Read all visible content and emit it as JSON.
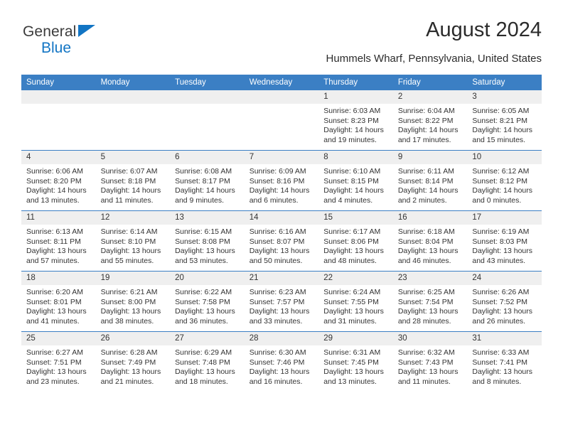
{
  "brand": {
    "name_part1": "General",
    "name_part2": "Blue",
    "accent_color": "#1275c4"
  },
  "header": {
    "title": "August 2024",
    "location": "Hummels Wharf, Pennsylvania, United States"
  },
  "theme": {
    "header_row_color": "#3b7fc4",
    "daynum_bg": "#efefef",
    "text_color": "#333333"
  },
  "weekday_headers": [
    "Sunday",
    "Monday",
    "Tuesday",
    "Wednesday",
    "Thursday",
    "Friday",
    "Saturday"
  ],
  "weeks": [
    [
      {
        "day": "",
        "sunrise": "",
        "sunset": "",
        "daylight1": "",
        "daylight2": "",
        "empty": true
      },
      {
        "day": "",
        "sunrise": "",
        "sunset": "",
        "daylight1": "",
        "daylight2": "",
        "empty": true
      },
      {
        "day": "",
        "sunrise": "",
        "sunset": "",
        "daylight1": "",
        "daylight2": "",
        "empty": true
      },
      {
        "day": "",
        "sunrise": "",
        "sunset": "",
        "daylight1": "",
        "daylight2": "",
        "empty": true
      },
      {
        "day": "1",
        "sunrise": "Sunrise: 6:03 AM",
        "sunset": "Sunset: 8:23 PM",
        "daylight1": "Daylight: 14 hours",
        "daylight2": "and 19 minutes."
      },
      {
        "day": "2",
        "sunrise": "Sunrise: 6:04 AM",
        "sunset": "Sunset: 8:22 PM",
        "daylight1": "Daylight: 14 hours",
        "daylight2": "and 17 minutes."
      },
      {
        "day": "3",
        "sunrise": "Sunrise: 6:05 AM",
        "sunset": "Sunset: 8:21 PM",
        "daylight1": "Daylight: 14 hours",
        "daylight2": "and 15 minutes."
      }
    ],
    [
      {
        "day": "4",
        "sunrise": "Sunrise: 6:06 AM",
        "sunset": "Sunset: 8:20 PM",
        "daylight1": "Daylight: 14 hours",
        "daylight2": "and 13 minutes."
      },
      {
        "day": "5",
        "sunrise": "Sunrise: 6:07 AM",
        "sunset": "Sunset: 8:18 PM",
        "daylight1": "Daylight: 14 hours",
        "daylight2": "and 11 minutes."
      },
      {
        "day": "6",
        "sunrise": "Sunrise: 6:08 AM",
        "sunset": "Sunset: 8:17 PM",
        "daylight1": "Daylight: 14 hours",
        "daylight2": "and 9 minutes."
      },
      {
        "day": "7",
        "sunrise": "Sunrise: 6:09 AM",
        "sunset": "Sunset: 8:16 PM",
        "daylight1": "Daylight: 14 hours",
        "daylight2": "and 6 minutes."
      },
      {
        "day": "8",
        "sunrise": "Sunrise: 6:10 AM",
        "sunset": "Sunset: 8:15 PM",
        "daylight1": "Daylight: 14 hours",
        "daylight2": "and 4 minutes."
      },
      {
        "day": "9",
        "sunrise": "Sunrise: 6:11 AM",
        "sunset": "Sunset: 8:14 PM",
        "daylight1": "Daylight: 14 hours",
        "daylight2": "and 2 minutes."
      },
      {
        "day": "10",
        "sunrise": "Sunrise: 6:12 AM",
        "sunset": "Sunset: 8:12 PM",
        "daylight1": "Daylight: 14 hours",
        "daylight2": "and 0 minutes."
      }
    ],
    [
      {
        "day": "11",
        "sunrise": "Sunrise: 6:13 AM",
        "sunset": "Sunset: 8:11 PM",
        "daylight1": "Daylight: 13 hours",
        "daylight2": "and 57 minutes."
      },
      {
        "day": "12",
        "sunrise": "Sunrise: 6:14 AM",
        "sunset": "Sunset: 8:10 PM",
        "daylight1": "Daylight: 13 hours",
        "daylight2": "and 55 minutes."
      },
      {
        "day": "13",
        "sunrise": "Sunrise: 6:15 AM",
        "sunset": "Sunset: 8:08 PM",
        "daylight1": "Daylight: 13 hours",
        "daylight2": "and 53 minutes."
      },
      {
        "day": "14",
        "sunrise": "Sunrise: 6:16 AM",
        "sunset": "Sunset: 8:07 PM",
        "daylight1": "Daylight: 13 hours",
        "daylight2": "and 50 minutes."
      },
      {
        "day": "15",
        "sunrise": "Sunrise: 6:17 AM",
        "sunset": "Sunset: 8:06 PM",
        "daylight1": "Daylight: 13 hours",
        "daylight2": "and 48 minutes."
      },
      {
        "day": "16",
        "sunrise": "Sunrise: 6:18 AM",
        "sunset": "Sunset: 8:04 PM",
        "daylight1": "Daylight: 13 hours",
        "daylight2": "and 46 minutes."
      },
      {
        "day": "17",
        "sunrise": "Sunrise: 6:19 AM",
        "sunset": "Sunset: 8:03 PM",
        "daylight1": "Daylight: 13 hours",
        "daylight2": "and 43 minutes."
      }
    ],
    [
      {
        "day": "18",
        "sunrise": "Sunrise: 6:20 AM",
        "sunset": "Sunset: 8:01 PM",
        "daylight1": "Daylight: 13 hours",
        "daylight2": "and 41 minutes."
      },
      {
        "day": "19",
        "sunrise": "Sunrise: 6:21 AM",
        "sunset": "Sunset: 8:00 PM",
        "daylight1": "Daylight: 13 hours",
        "daylight2": "and 38 minutes."
      },
      {
        "day": "20",
        "sunrise": "Sunrise: 6:22 AM",
        "sunset": "Sunset: 7:58 PM",
        "daylight1": "Daylight: 13 hours",
        "daylight2": "and 36 minutes."
      },
      {
        "day": "21",
        "sunrise": "Sunrise: 6:23 AM",
        "sunset": "Sunset: 7:57 PM",
        "daylight1": "Daylight: 13 hours",
        "daylight2": "and 33 minutes."
      },
      {
        "day": "22",
        "sunrise": "Sunrise: 6:24 AM",
        "sunset": "Sunset: 7:55 PM",
        "daylight1": "Daylight: 13 hours",
        "daylight2": "and 31 minutes."
      },
      {
        "day": "23",
        "sunrise": "Sunrise: 6:25 AM",
        "sunset": "Sunset: 7:54 PM",
        "daylight1": "Daylight: 13 hours",
        "daylight2": "and 28 minutes."
      },
      {
        "day": "24",
        "sunrise": "Sunrise: 6:26 AM",
        "sunset": "Sunset: 7:52 PM",
        "daylight1": "Daylight: 13 hours",
        "daylight2": "and 26 minutes."
      }
    ],
    [
      {
        "day": "25",
        "sunrise": "Sunrise: 6:27 AM",
        "sunset": "Sunset: 7:51 PM",
        "daylight1": "Daylight: 13 hours",
        "daylight2": "and 23 minutes."
      },
      {
        "day": "26",
        "sunrise": "Sunrise: 6:28 AM",
        "sunset": "Sunset: 7:49 PM",
        "daylight1": "Daylight: 13 hours",
        "daylight2": "and 21 minutes."
      },
      {
        "day": "27",
        "sunrise": "Sunrise: 6:29 AM",
        "sunset": "Sunset: 7:48 PM",
        "daylight1": "Daylight: 13 hours",
        "daylight2": "and 18 minutes."
      },
      {
        "day": "28",
        "sunrise": "Sunrise: 6:30 AM",
        "sunset": "Sunset: 7:46 PM",
        "daylight1": "Daylight: 13 hours",
        "daylight2": "and 16 minutes."
      },
      {
        "day": "29",
        "sunrise": "Sunrise: 6:31 AM",
        "sunset": "Sunset: 7:45 PM",
        "daylight1": "Daylight: 13 hours",
        "daylight2": "and 13 minutes."
      },
      {
        "day": "30",
        "sunrise": "Sunrise: 6:32 AM",
        "sunset": "Sunset: 7:43 PM",
        "daylight1": "Daylight: 13 hours",
        "daylight2": "and 11 minutes."
      },
      {
        "day": "31",
        "sunrise": "Sunrise: 6:33 AM",
        "sunset": "Sunset: 7:41 PM",
        "daylight1": "Daylight: 13 hours",
        "daylight2": "and 8 minutes."
      }
    ]
  ]
}
